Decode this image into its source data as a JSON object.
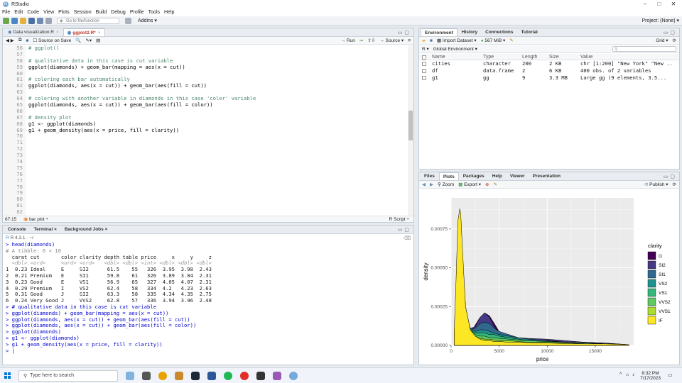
{
  "window": {
    "title": "RStudio",
    "app_icon": "R"
  },
  "menu": [
    "File",
    "Edit",
    "Code",
    "View",
    "Plots",
    "Session",
    "Build",
    "Debug",
    "Profile",
    "Tools",
    "Help"
  ],
  "toolbar": {
    "goto_placeholder": "Go to file/function",
    "addins": "Addins ▾",
    "project": "Project: (None) ▾"
  },
  "editor": {
    "tabs": [
      {
        "label": "Data visualization.R"
      },
      {
        "label": "ggplot2.R*"
      }
    ],
    "source_on_save": "Source on Save",
    "run": "→ Run",
    "source": "→ Source ▾",
    "lines": [
      {
        "n": "56",
        "text": "# ggplot()",
        "comment": true
      },
      {
        "n": "57",
        "text": "",
        "comment": false
      },
      {
        "n": "58",
        "text": "# qualitative data in this case is cut variable",
        "comment": true
      },
      {
        "n": "59",
        "text": "ggplot(diamonds) + geom_bar(mapping = aes(x = cut))",
        "comment": false
      },
      {
        "n": "60",
        "text": "",
        "comment": false
      },
      {
        "n": "61",
        "text": "# coloring each bar automatically",
        "comment": true
      },
      {
        "n": "62",
        "text": "ggplot(diamonds, aes(x = cut)) + geom_bar(aes(fill = cut))",
        "comment": false
      },
      {
        "n": "63",
        "text": "",
        "comment": false
      },
      {
        "n": "64",
        "text": "# coloring with another variable in diamonds in this case 'color' variable",
        "comment": true
      },
      {
        "n": "65",
        "text": "ggplot(diamonds, aes(x = cut)) + geom_bar(aes(fill = color))",
        "comment": false
      },
      {
        "n": "66",
        "text": "",
        "comment": false
      },
      {
        "n": "67",
        "text": "# density plot",
        "comment": true
      },
      {
        "n": "68",
        "text": "g1 <- ggplot(diamonds)",
        "comment": false
      },
      {
        "n": "69",
        "text": "g1 + geom_density(aes(x = price, fill = clarity))",
        "comment": false
      },
      {
        "n": "70",
        "text": "",
        "comment": false
      },
      {
        "n": "71",
        "text": "",
        "comment": false
      },
      {
        "n": "72",
        "text": "",
        "comment": false
      },
      {
        "n": "73",
        "text": "",
        "comment": false
      },
      {
        "n": "74",
        "text": "",
        "comment": false
      },
      {
        "n": "75",
        "text": "",
        "comment": false
      },
      {
        "n": "76",
        "text": "",
        "comment": false
      },
      {
        "n": "77",
        "text": "",
        "comment": false
      },
      {
        "n": "78",
        "text": "",
        "comment": false
      },
      {
        "n": "79",
        "text": "",
        "comment": false
      },
      {
        "n": "80",
        "text": "",
        "comment": false
      },
      {
        "n": "81",
        "text": "",
        "comment": false
      },
      {
        "n": "82",
        "text": "",
        "comment": false
      }
    ],
    "status_pos": "67:15",
    "status_section": "bar plot ÷",
    "status_type": "R Script ÷"
  },
  "console": {
    "tabs": [
      "Console",
      "Terminal ×",
      "Background Jobs ×"
    ],
    "version": "R 4.3.1 · ~/",
    "lines": [
      {
        "text": "> head(diamonds)",
        "kind": "cmd"
      },
      {
        "text": "# A tibble: 6 × 10",
        "kind": "dim"
      },
      {
        "text": "  carat cut       color clarity depth table price     x     y     z",
        "kind": "out"
      },
      {
        "text": "  <dbl> <ord>     <ord> <ord>   <dbl> <dbl> <int> <dbl> <dbl> <dbl>",
        "kind": "type"
      },
      {
        "text": "1  0.23 Ideal     E     SI2      61.5    55   326  3.95  3.98  2.43",
        "kind": "out"
      },
      {
        "text": "2  0.21 Premium   E     SI1      59.8    61   326  3.89  3.84  2.31",
        "kind": "out"
      },
      {
        "text": "3  0.23 Good      E     VS1      56.9    65   327  4.05  4.07  2.31",
        "kind": "out"
      },
      {
        "text": "4  0.29 Premium   I     VS2      62.4    58   334  4.2   4.23  2.63",
        "kind": "out"
      },
      {
        "text": "5  0.31 Good      J     SI2      63.3    58   335  4.34  4.35  2.75",
        "kind": "out"
      },
      {
        "text": "6  0.24 Very Good J     VVS2     62.8    57   336  3.94  3.96  2.48",
        "kind": "out"
      },
      {
        "text": "> # qualitative data in this case is cut variable",
        "kind": "cmd"
      },
      {
        "text": "> ggplot(diamonds) + geom_bar(mapping = aes(x = cut))",
        "kind": "cmd"
      },
      {
        "text": "> ggplot(diamonds, aes(x = cut)) + geom_bar(aes(fill = cut))",
        "kind": "cmd"
      },
      {
        "text": "> ggplot(diamonds, aes(x = cut)) + geom_bar(aes(fill = color))",
        "kind": "cmd"
      },
      {
        "text": "> ggplot(diamonds)",
        "kind": "cmd"
      },
      {
        "text": "> g1 <- ggplot(diamonds)",
        "kind": "cmd"
      },
      {
        "text": "> g1 + geom_density(aes(x = price, fill = clarity))",
        "kind": "cmd"
      },
      {
        "text": "> |",
        "kind": "cmd"
      }
    ]
  },
  "environment": {
    "tabs": [
      "Environment",
      "History",
      "Connections",
      "Tutorial"
    ],
    "import": "Import Dataset ▾",
    "memory": "567 MiB ▾",
    "view_mode": "Grid ▾",
    "lang": "R ▾",
    "scope": "Global Environment ▾",
    "headers": [
      "Name",
      "Type",
      "Length",
      "Size",
      "Value"
    ],
    "rows": [
      {
        "name": "cities",
        "type": "character",
        "length": "200",
        "size": "2 KB",
        "value": "chr [1:200] \"New York\" \"New ..."
      },
      {
        "name": "df",
        "type": "data.frame",
        "length": "2",
        "size": "6 KB",
        "value": "400 obs. of 2 variables"
      },
      {
        "name": "g1",
        "type": "gg",
        "length": "9",
        "size": "3.3 MB",
        "value": "Large gg (9 elements, 3.5..."
      }
    ]
  },
  "plots_pane": {
    "tabs": [
      "Files",
      "Plots",
      "Packages",
      "Help",
      "Viewer",
      "Presentation"
    ],
    "zoom": "Zoom",
    "export": "Export ▾",
    "publish": "Publish ▾"
  },
  "chart_data": {
    "type": "area",
    "title": "",
    "xlabel": "price",
    "ylabel": "density",
    "xlim": [
      0,
      19000
    ],
    "ylim": [
      0,
      0.00095
    ],
    "x_ticks": [
      0,
      5000,
      10000,
      15000
    ],
    "x_tick_labels": [
      "0",
      "5000",
      "10000",
      "15000"
    ],
    "y_ticks": [
      0,
      0.00025,
      0.0005,
      0.00075
    ],
    "y_tick_labels": [
      "0.00000",
      "0.00025",
      "0.00050",
      "0.00075"
    ],
    "legend_title": "clarity",
    "legend_position": "right",
    "x": [
      326,
      500,
      700,
      900,
      1000,
      1200,
      1500,
      2000,
      2500,
      3000,
      3500,
      4000,
      4500,
      5000,
      6000,
      7000,
      8000,
      10000,
      12000,
      14000,
      16000,
      18500
    ],
    "series": [
      {
        "name": "I1",
        "color": "#440154",
        "values": [
          1e-05,
          2e-05,
          5e-05,
          0.0001,
          0.00012,
          0.00013,
          0.00011,
          8e-05,
          0.00013,
          0.00018,
          0.00021,
          0.00019,
          0.00014,
          9e-05,
          6e-05,
          5e-05,
          4e-05,
          3e-05,
          2.5e-05,
          2e-05,
          1.5e-05,
          5e-06
        ]
      },
      {
        "name": "SI2",
        "color": "#443983",
        "values": [
          2e-05,
          4e-05,
          6e-05,
          9e-05,
          0.0001,
          0.00011,
          0.00012,
          0.00011,
          0.00012,
          0.00018,
          0.00021,
          0.00018,
          0.00012,
          8e-05,
          6e-05,
          5e-05,
          4.5e-05,
          4e-05,
          3e-05,
          2e-05,
          1.5e-05,
          5e-06
        ]
      },
      {
        "name": "SI1",
        "color": "#31688e",
        "values": [
          5e-05,
          0.0001,
          0.00016,
          0.00022,
          0.00024,
          0.00022,
          0.00016,
          0.0001,
          0.00011,
          0.00014,
          0.00015,
          0.00014,
          0.00011,
          9e-05,
          7e-05,
          5e-05,
          4e-05,
          3e-05,
          2e-05,
          1.5e-05,
          1e-05,
          5e-06
        ]
      },
      {
        "name": "VS2",
        "color": "#21918c",
        "values": [
          6e-05,
          0.0002,
          0.00045,
          0.00055,
          0.00052,
          0.0004,
          0.00022,
          0.00011,
          9e-05,
          0.0001,
          0.0001,
          9e-05,
          8e-05,
          7e-05,
          6e-05,
          5e-05,
          4e-05,
          3e-05,
          2e-05,
          1.5e-05,
          1e-05,
          5e-06
        ]
      },
      {
        "name": "VS1",
        "color": "#35b779",
        "values": [
          6e-05,
          0.00025,
          0.0005,
          0.00062,
          0.00058,
          0.00042,
          0.0002,
          0.0001,
          8e-05,
          8e-05,
          8e-05,
          7e-05,
          7e-05,
          6e-05,
          5e-05,
          4e-05,
          3e-05,
          2.5e-05,
          2e-05,
          1.5e-05,
          1e-05,
          5e-06
        ]
      },
      {
        "name": "VVS2",
        "color": "#5ec962",
        "values": [
          7e-05,
          0.0003,
          0.0006,
          0.00075,
          0.0007,
          0.0005,
          0.00022,
          0.0001,
          7e-05,
          6e-05,
          6e-05,
          5e-05,
          5e-05,
          4.5e-05,
          4e-05,
          3.5e-05,
          3e-05,
          2.5e-05,
          2e-05,
          1.5e-05,
          1e-05,
          5e-06
        ]
      },
      {
        "name": "VVS1",
        "color": "#addc30",
        "values": [
          8e-05,
          0.00035,
          0.00068,
          0.0008,
          0.00078,
          0.00055,
          0.00025,
          0.0001,
          6e-05,
          4.5e-05,
          4e-05,
          4e-05,
          3.5e-05,
          3e-05,
          3e-05,
          2.5e-05,
          2e-05,
          2e-05,
          1.5e-05,
          1e-05,
          1e-05,
          5e-06
        ]
      },
      {
        "name": "IF",
        "color": "#fde725",
        "values": [
          0.0001,
          0.0004,
          0.0008,
          0.00088,
          0.00085,
          0.0006,
          0.00025,
          0.0001,
          6e-05,
          4e-05,
          3e-05,
          3e-05,
          2.5e-05,
          2.5e-05,
          2e-05,
          2e-05,
          1.8e-05,
          1.5e-05,
          1.2e-05,
          1e-05,
          1e-05,
          5e-06
        ]
      }
    ]
  },
  "taskbar": {
    "search_placeholder": "Type here to search",
    "time": "8:32 PM",
    "date": "7/17/2023"
  }
}
